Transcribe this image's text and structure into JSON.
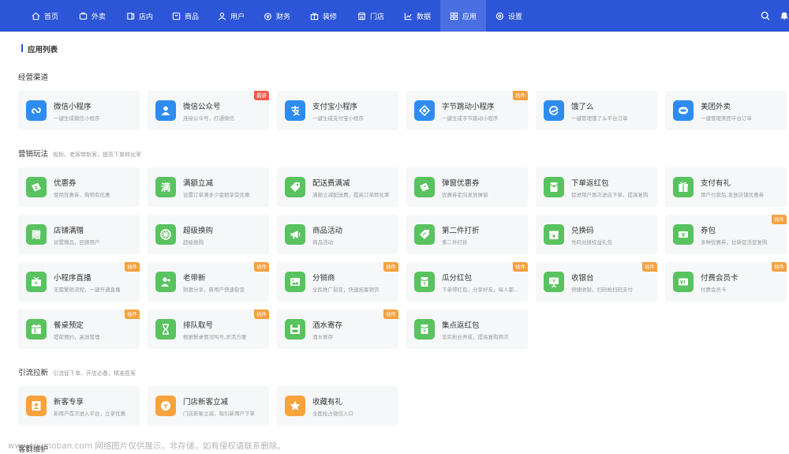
{
  "nav": {
    "items": [
      {
        "label": "首页",
        "icon": "home-icon"
      },
      {
        "label": "外卖",
        "icon": "takeout-icon"
      },
      {
        "label": "店内",
        "icon": "store-in-icon"
      },
      {
        "label": "商品",
        "icon": "goods-icon"
      },
      {
        "label": "用户",
        "icon": "user-icon"
      },
      {
        "label": "财务",
        "icon": "finance-icon"
      },
      {
        "label": "装修",
        "icon": "decor-icon"
      },
      {
        "label": "门店",
        "icon": "shop-icon"
      },
      {
        "label": "数据",
        "icon": "data-icon"
      },
      {
        "label": "应用",
        "icon": "apps-icon"
      },
      {
        "label": "设置",
        "icon": "gear-icon"
      }
    ],
    "active": "应用"
  },
  "page": {
    "title": "应用列表"
  },
  "sections": [
    {
      "title": "经营渠道",
      "subtitle": ""
    },
    {
      "title": "营销玩法",
      "subtitle": "吸粉、老客带新客，提高下单转化率"
    },
    {
      "title": "引流拉新",
      "subtitle": "引流促下单、开店必备，精准揽客"
    },
    {
      "title": "客群维护",
      "subtitle": ""
    }
  ],
  "cards": {
    "channels": [
      {
        "name": "微信小程序",
        "desc": "一键生成微信小程序",
        "badge": ""
      },
      {
        "name": "微信公众号",
        "desc": "连接公众号，打通微信",
        "badge": "最新"
      },
      {
        "name": "支付宝小程序",
        "desc": "一键生成支付宝小程序",
        "badge": ""
      },
      {
        "name": "字节跳动小程序",
        "desc": "一键生成字节跳动小程序",
        "badge": "插件"
      },
      {
        "name": "饿了么",
        "desc": "一键管理饿了么平台订单",
        "badge": ""
      },
      {
        "name": "美团外卖",
        "desc": "一键管理美团平台订单",
        "badge": ""
      }
    ],
    "marketing": [
      {
        "name": "优惠券",
        "desc": "使用优惠券，购物有优惠",
        "badge": ""
      },
      {
        "name": "满额立减",
        "desc": "设置订单满多少金额享受优惠",
        "badge": ""
      },
      {
        "name": "配送费满减",
        "desc": "满额立减配送费，提高订单转化率",
        "badge": ""
      },
      {
        "name": "弹窗优惠券",
        "desc": "优惠券定向发放弹窗",
        "badge": ""
      },
      {
        "name": "下单返红包",
        "desc": "促进用户再次进店下单，提高复购",
        "badge": ""
      },
      {
        "name": "支付有礼",
        "desc": "用户付款后,发放店铺优惠券",
        "badge": ""
      },
      {
        "name": "店铺满赠",
        "desc": "设置赠品，回馈用户",
        "badge": ""
      },
      {
        "name": "超级换购",
        "desc": "超级换购",
        "badge": ""
      },
      {
        "name": "商品活动",
        "desc": "商品活动",
        "badge": ""
      },
      {
        "name": "第二件打折",
        "desc": "第二件打折",
        "badge": ""
      },
      {
        "name": "兑换码",
        "desc": "凭码兑换权益礼包",
        "badge": ""
      },
      {
        "name": "券包",
        "desc": "多种优惠券，拉新促活促复购",
        "badge": "插件"
      },
      {
        "name": "小程序直播",
        "desc": "无需繁琐流程，一键开通直播",
        "badge": "插件"
      },
      {
        "name": "老带新",
        "desc": "刺激分享，新用户快速裂变",
        "badge": "插件"
      },
      {
        "name": "分销商",
        "desc": "全民推广裂变，快速拓客销货",
        "badge": "插件"
      },
      {
        "name": "瓜分红包",
        "desc": "下单得红包，分享好友，每人都能得",
        "badge": "插件"
      },
      {
        "name": "收银台",
        "desc": "快捷收银，扫码枪扫码支付",
        "badge": "插件"
      },
      {
        "name": "付费会员卡",
        "desc": "付费会员卡",
        "badge": "插件"
      },
      {
        "name": "餐桌预定",
        "desc": "提前预约，高效管理",
        "badge": "插件"
      },
      {
        "name": "排队取号",
        "desc": "根据餐桌情况叫号,灵活方便",
        "badge": "插件"
      },
      {
        "name": "酒水寄存",
        "desc": "酒水寄存",
        "badge": "插件"
      },
      {
        "name": "集点返红包",
        "desc": "忠实粉丝养成，提高复购频次",
        "badge": ""
      }
    ],
    "traffic": [
      {
        "name": "新客专享",
        "desc": "新用户首次进入平台，立享优惠",
        "badge": ""
      },
      {
        "name": "门店新客立减",
        "desc": "门店新客立减，吸引新用户下单",
        "badge": ""
      },
      {
        "name": "收藏有礼",
        "desc": "全面抢占微信入口",
        "badge": ""
      }
    ]
  },
  "watermark": "www.toymoban.com 网络图片仅供展示，非存储，如有侵权请联系删除。",
  "colors": {
    "nav_bg": "#2d55d8",
    "blue": "#2e8cf0",
    "green": "#58c35f",
    "orange": "#f7a23a",
    "plugin_badge": "#f5a03c",
    "new_badge": "#f05a4a"
  }
}
